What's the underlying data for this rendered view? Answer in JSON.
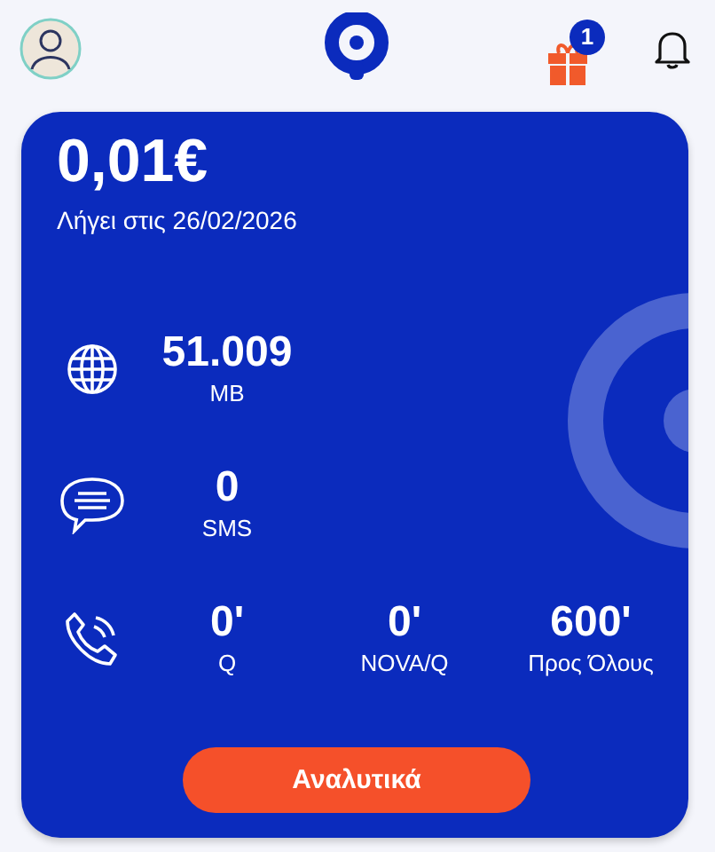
{
  "header": {
    "gift_badge": "1"
  },
  "balance": {
    "amount": "0,01€",
    "expiry": "Λήγει στις 26/02/2026"
  },
  "usage": [
    {
      "kind": "data",
      "items": [
        {
          "value": "51.009",
          "unit": "MB"
        }
      ]
    },
    {
      "kind": "sms",
      "items": [
        {
          "value": "0",
          "unit": "SMS"
        }
      ]
    },
    {
      "kind": "voice",
      "items": [
        {
          "value": "0'",
          "unit": "Q"
        },
        {
          "value": "0'",
          "unit": "NOVA/Q"
        },
        {
          "value": "600'",
          "unit": "Προς Όλους"
        }
      ]
    }
  ],
  "button": "Αναλυτικά"
}
